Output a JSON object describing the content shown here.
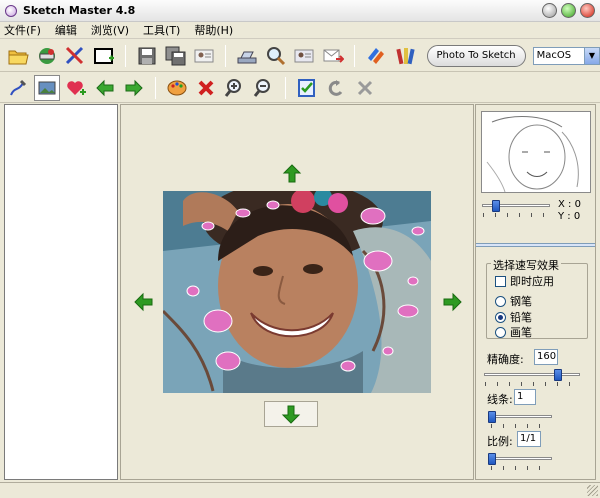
{
  "window": {
    "title": "Sketch Master 4.8"
  },
  "menu": [
    "文件(F)",
    "编辑",
    "浏览(V)",
    "工具(T)",
    "帮助(H)"
  ],
  "toolbar1": {
    "photo_to_sketch_label": "Photo To Sketch",
    "style_select": {
      "value": "MacOS"
    }
  },
  "right_panel": {
    "coord_x": "X : 0",
    "coord_y": "Y : 0",
    "effect_group_title": "选择速写效果",
    "instant_apply_label": "即时应用",
    "effects": [
      {
        "label": "钢笔",
        "selected": false
      },
      {
        "label": "铅笔",
        "selected": true
      },
      {
        "label": "画笔",
        "selected": false
      }
    ],
    "precision_label": "精确度:",
    "precision_value": "160",
    "precision_level": 0.8,
    "lines_label": "线条:",
    "lines_value": "1",
    "ratio_label": "比例:",
    "ratio_value": "1/1"
  },
  "colors": {
    "arrow_green": "#2e9a22",
    "accent_blue": "#2058c0",
    "pink": "#e070c0"
  }
}
